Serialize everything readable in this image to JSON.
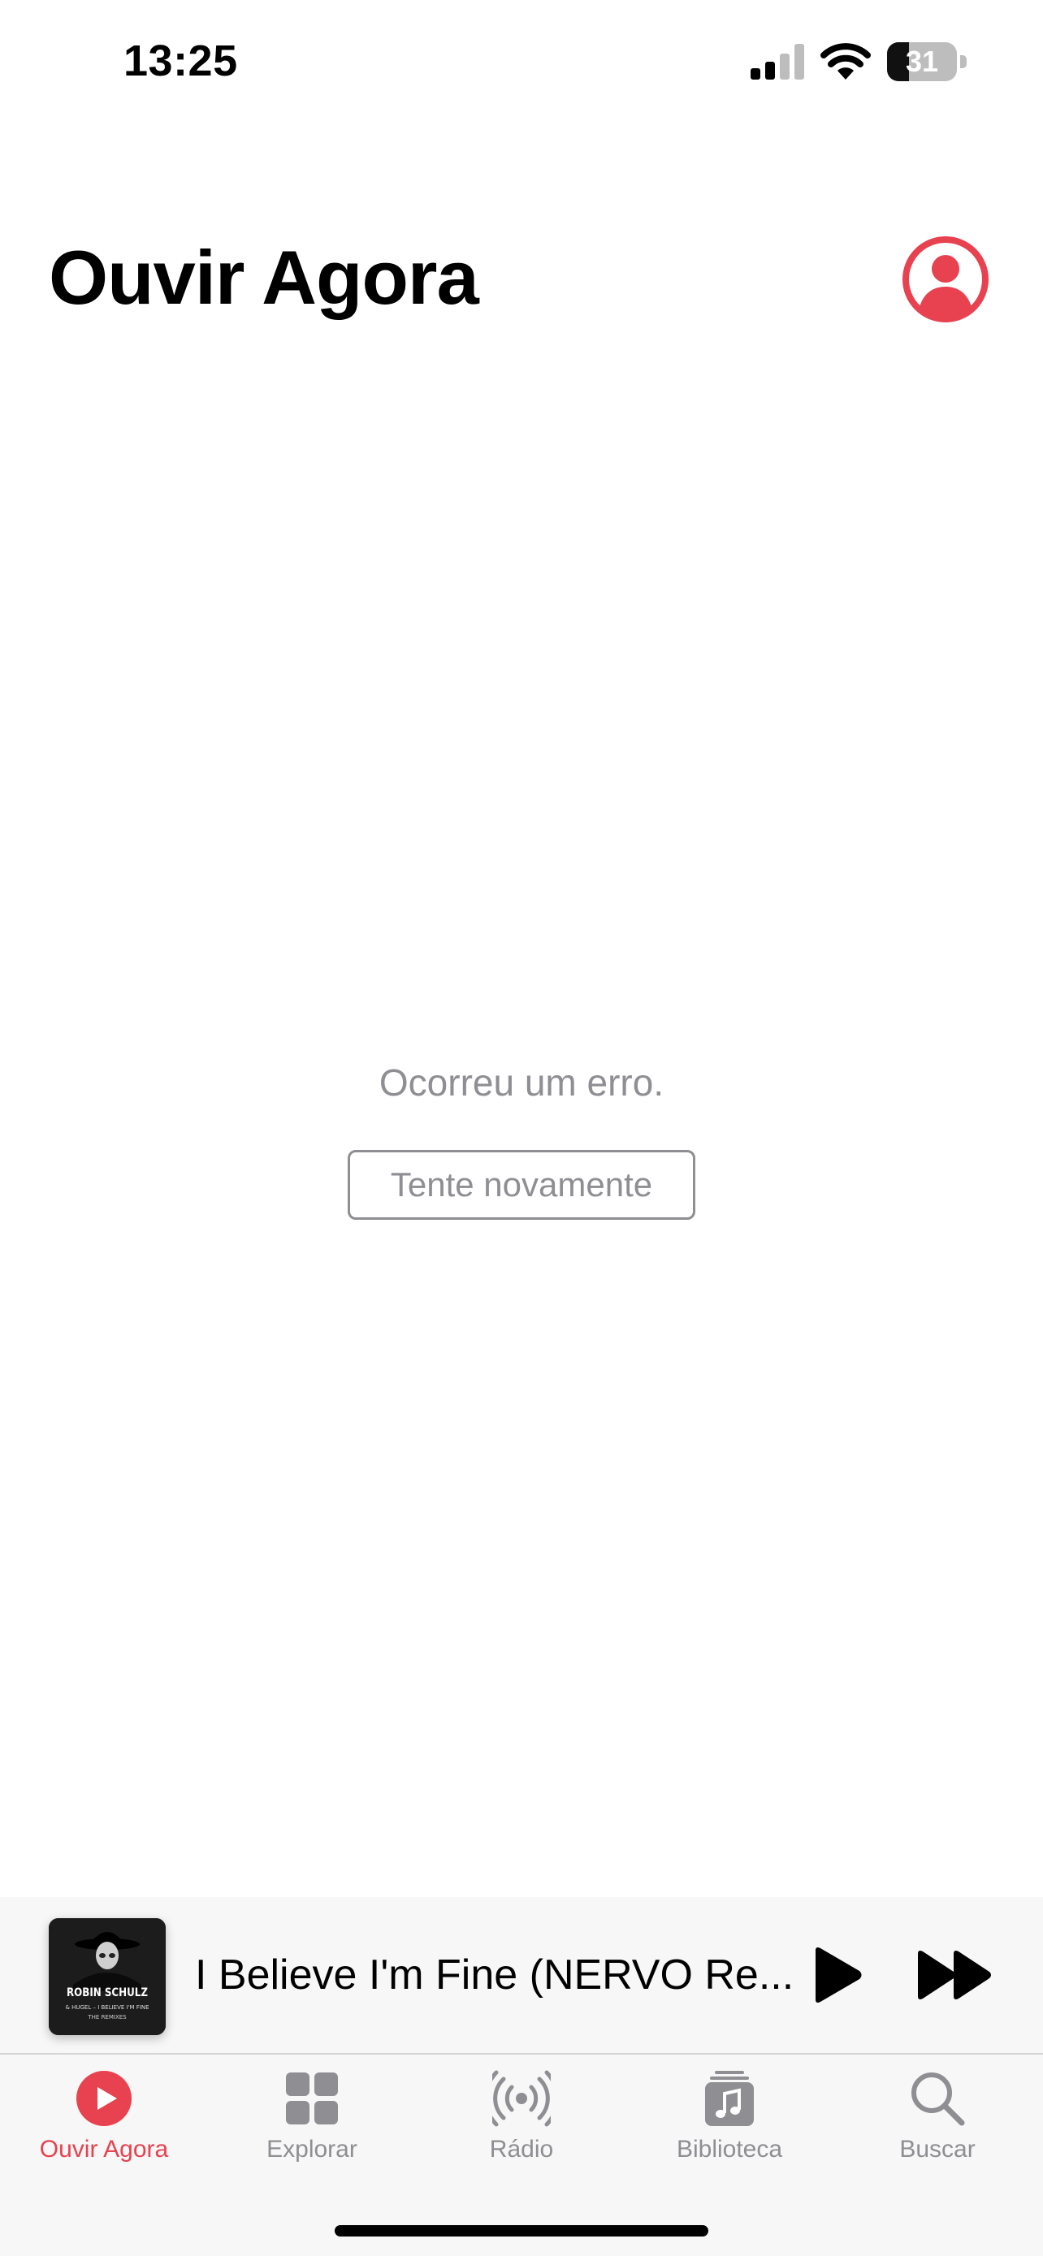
{
  "status_bar": {
    "time": "13:25",
    "battery_level": "31",
    "battery_fraction": 0.31
  },
  "header": {
    "title": "Ouvir Agora",
    "account_icon": "person-circle-icon"
  },
  "content": {
    "error_message": "Ocorreu um erro.",
    "retry_label": "Tente novamente"
  },
  "mini_player": {
    "artwork": {
      "artist": "ROBIN SCHULZ",
      "track": "& HUGEL – I BELIEVE I'M FINE",
      "subtitle": "THE REMIXES"
    },
    "title": "I Believe I'm Fine (NERVO Re...",
    "play_icon": "play-icon",
    "forward_icon": "fast-forward-icon"
  },
  "tabs": [
    {
      "label": "Ouvir Agora",
      "icon": "play-circle-icon",
      "active": true
    },
    {
      "label": "Explorar",
      "icon": "grid-icon",
      "active": false
    },
    {
      "label": "Rádio",
      "icon": "radio-waves-icon",
      "active": false
    },
    {
      "label": "Biblioteca",
      "icon": "music-library-icon",
      "active": false
    },
    {
      "label": "Buscar",
      "icon": "search-icon",
      "active": false
    }
  ],
  "colors": {
    "accent": "#e8414f",
    "secondary_text": "#8e8e93",
    "bar_background": "#f7f7f7"
  }
}
